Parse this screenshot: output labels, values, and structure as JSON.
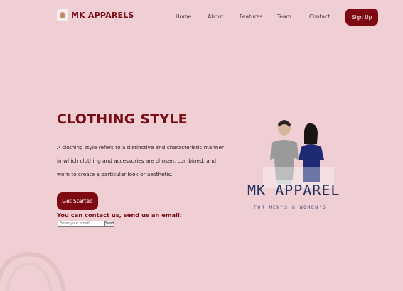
{
  "brand": {
    "name": "MK APPARELS",
    "logo_icon": "logo-icon"
  },
  "nav": [
    {
      "label": "Home"
    },
    {
      "label": "About"
    },
    {
      "label": "Features"
    },
    {
      "label": "Team"
    },
    {
      "label": "Contact"
    }
  ],
  "header": {
    "signup_label": "Sign Up"
  },
  "hero": {
    "title": "CLOTHING STYLE",
    "description": "A clothing style refers to a distinctive and characteristic manner in which clothing and accessories are chosen, combined, and worn to create a particular look or aesthetic.",
    "cta_label": "Get Started",
    "contact_text": "You can contact us, send us an email:",
    "email_placeholder": "Enter your email",
    "send_label": "Send"
  },
  "illustration": {
    "brand_text": "MK APPAREL",
    "tagline": "FOR MEN'S & WOMEN'S"
  },
  "colors": {
    "background": "#efcfd4",
    "accent": "#7d0a13",
    "brand_blue": "#1f2f5a"
  }
}
